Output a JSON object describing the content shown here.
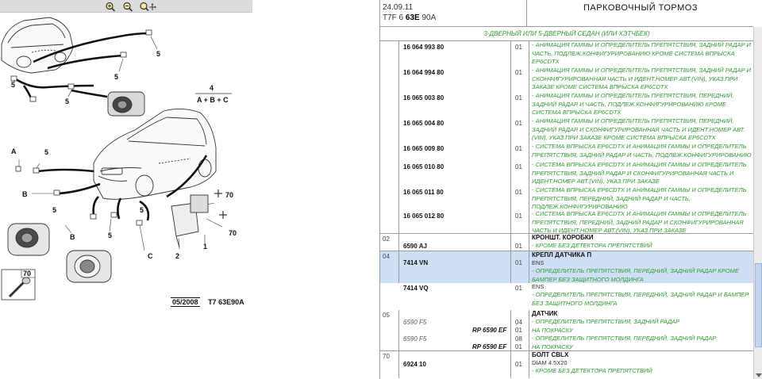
{
  "diagram": {
    "toolbar": {
      "zoom_in": "zoom-in-icon",
      "zoom_out": "zoom-out-icon",
      "zoom_pan": "zoom-pan-icon"
    },
    "callouts": {
      "c5a": "5",
      "c5b": "5",
      "c5c": "5",
      "c5d": "5",
      "c5e": "5",
      "c5f": "5",
      "c5g": "5",
      "c4": "4",
      "formula": "A + B + C",
      "cA": "A",
      "cB1": "B",
      "cB2": "B",
      "cC": "C",
      "c70a": "70",
      "c70b": "70",
      "c70c": "70",
      "c1": "1",
      "c2": "2"
    },
    "ref_date": "05/2008",
    "ref_code": "T7 63E90A"
  },
  "header": {
    "date": "24.09.11",
    "code_prefix": "T7F 6",
    "code_bold": "63E",
    "code_suffix": "90A",
    "title": "ПАРКОВОЧНЫЙ ТОРМОЗ"
  },
  "variant": "3-ДВЕРНЫЙ ИЛИ 5-ДВЕРНЫЙ СЕДАН (ИЛИ ХЭТЧБЕК)",
  "group_top": {
    "parts": [
      {
        "pn": "16 064 993 80",
        "qty": "01",
        "desc": "- АНИМАЦИЯ ГАММЫ И ОПРЕДЕЛИТЕЛЬ ПРЕПЯТСТВИЯ, ЗАДНИЙ РАДАР И ЧАСТЬ, ПОДЛЕЖ.КОНФИГУРИРОВАНИЮ КРОМЕ СИСТЕМА ВПРЫСКА EP6CDTX"
      },
      {
        "pn": "16 064 994 80",
        "qty": "01",
        "desc": "- АНИМАЦИЯ ГАММЫ И ОПРЕДЕЛИТЕЛЬ ПРЕПЯТСТВИЯ, ЗАДНИЙ РАДАР И СКОНФИГУРИРОВАННАЯ ЧАСТЬ И ИДЕНТ.НОМЕР АВТ.(VIN), УКАЗ.ПРИ ЗАКАЗЕ КРОМЕ СИСТЕМА ВПРЫСКА EP6CDTX"
      },
      {
        "pn": "16 065 003 80",
        "qty": "01",
        "desc": "- АНИМАЦИЯ ГАММЫ И ОПРЕДЕЛИТЕЛЬ ПРЕПЯТСТВИЯ, ПЕРЕДНИЙ, ЗАДНИЙ РАДАР И ЧАСТЬ, ПОДЛЕЖ.КОНФИГУРИРОВАНИЮ КРОМЕ СИСТЕМА ВПРЫСКА EP6CDTX"
      },
      {
        "pn": "16 065 004 80",
        "qty": "01",
        "desc": "- АНИМАЦИЯ ГАММЫ И ОПРЕДЕЛИТЕЛЬ ПРЕПЯТСТВИЯ, ПЕРЕДНИЙ, ЗАДНИЙ РАДАР И СКОНФИГУРИРОВАННАЯ ЧАСТЬ И ИДЕНТ.НОМЕР АВТ.(VIN), УКАЗ.ПРИ ЗАКАЗЕ КРОМЕ СИСТЕМА ВПРЫСКА EP6CDTX"
      },
      {
        "pn": "16 065 009 80",
        "qty": "01",
        "desc": "- СИСТЕМА ВПРЫСКА EP6CDTX И АНИМАЦИЯ ГАММЫ И ОПРЕДЕЛИТЕЛЬ ПРЕПЯТСТВИЯ, ЗАДНИЙ РАДАР И ЧАСТЬ, ПОДЛЕЖ.КОНФИГУРИРОВАНИЮ"
      },
      {
        "pn": "16 065 010 80",
        "qty": "01",
        "desc": "- СИСТЕМА ВПРЫСКА EP6CDTX И АНИМАЦИЯ ГАММЫ И ОПРЕДЕЛИТЕЛЬ ПРЕПЯТСТВИЯ, ЗАДНИЙ РАДАР И СКОНФИГУРИРОВАННАЯ ЧАСТЬ И ИДЕНТ.НОМЕР АВТ.(VIN), УКАЗ.ПРИ ЗАКАЗЕ"
      },
      {
        "pn": "16 065 011 80",
        "qty": "01",
        "desc": "- СИСТЕМА ВПРЫСКА EP6CDTX И АНИМАЦИЯ ГАММЫ И ОПРЕДЕЛИТЕЛЬ ПРЕПЯТСТВИЯ, ПЕРЕДНИЙ, ЗАДНИЙ РАДАР И ЧАСТЬ, ПОДЛЕЖ.КОНФИГУРИРОВАНИЮ"
      },
      {
        "pn": "16 065 012 80",
        "qty": "01",
        "desc": "- СИСТЕМА ВПРЫСКА EP6CDTX И АНИМАЦИЯ ГАММЫ И ОПРЕДЕЛИТЕЛЬ ПРЕПЯТСТВИЯ, ПЕРЕДНИЙ, ЗАДНИЙ РАДАР И СКОНФИГУРИРОВАННАЯ ЧАСТЬ И ИДЕНТ.НОМЕР АВТ.(VIN), УКАЗ.ПРИ ЗАКАЗЕ"
      }
    ]
  },
  "group02": {
    "num": "02",
    "pn": "6590 AJ",
    "qty": "01",
    "title": "КРОНШТ. КОРОБКИ",
    "desc": "- КРОМЕ БЕЗ ДЕТЕКТОРА ПРЕПЯТСТВИЙ"
  },
  "group04": {
    "num": "04",
    "p1": {
      "pn": "7414 VN",
      "qty": "01",
      "title": "КРЕПЛ ДАТЧИКА П",
      "sub": "ENS",
      "desc": "- ОПРЕДЕЛИТЕЛЬ ПРЕПЯТСТВИЯ, ПЕРЕДНИЙ, ЗАДНИЙ РАДАР КРОМЕ БАМПЕР БЕЗ ЗАЩИТНОГО МОЛДИНГА"
    },
    "p2": {
      "pn": "7414 VQ",
      "qty": "01",
      "sub": "ENS",
      "desc": "- ОПРЕДЕЛИТЕЛЬ ПРЕПЯТСТВИЯ, ПЕРЕДНИЙ, ЗАДНИЙ РАДАР И БАМПЕР БЕЗ ЗАЩИТНОГО МОЛДИНГА"
    }
  },
  "group05": {
    "num": "05",
    "title": "ДАТЧИК",
    "p1": {
      "pn": "6590 F5",
      "qty": "04",
      "rp": "RP 6590 EF",
      "rp_qty": "01",
      "desc": "- ОПРЕДЕЛИТЕЛЬ ПРЕПЯТСТВИЯ, ЗАДНИЙ РАДАР",
      "note": "НА ПОКРАСКУ"
    },
    "p2": {
      "pn": "6590 F5",
      "qty": "08",
      "rp": "RP 6590 EF",
      "rp_qty": "01",
      "desc": "- ОПРЕДЕЛИТЕЛЬ ПРЕПЯТСТВИЯ, ПЕРЕДНИЙ, ЗАДНИЙ РАДАР",
      "note": "НА ПОКРАСКУ"
    }
  },
  "group70": {
    "num": "70",
    "pn": "6924 10",
    "qty": "01",
    "title": "БОЛТ СВLX",
    "sub": "DIAM 4.5X20",
    "desc": "- КРОМЕ БЕЗ ДЕТЕКТОРА ПРЕПЯТСТВИЙ"
  }
}
